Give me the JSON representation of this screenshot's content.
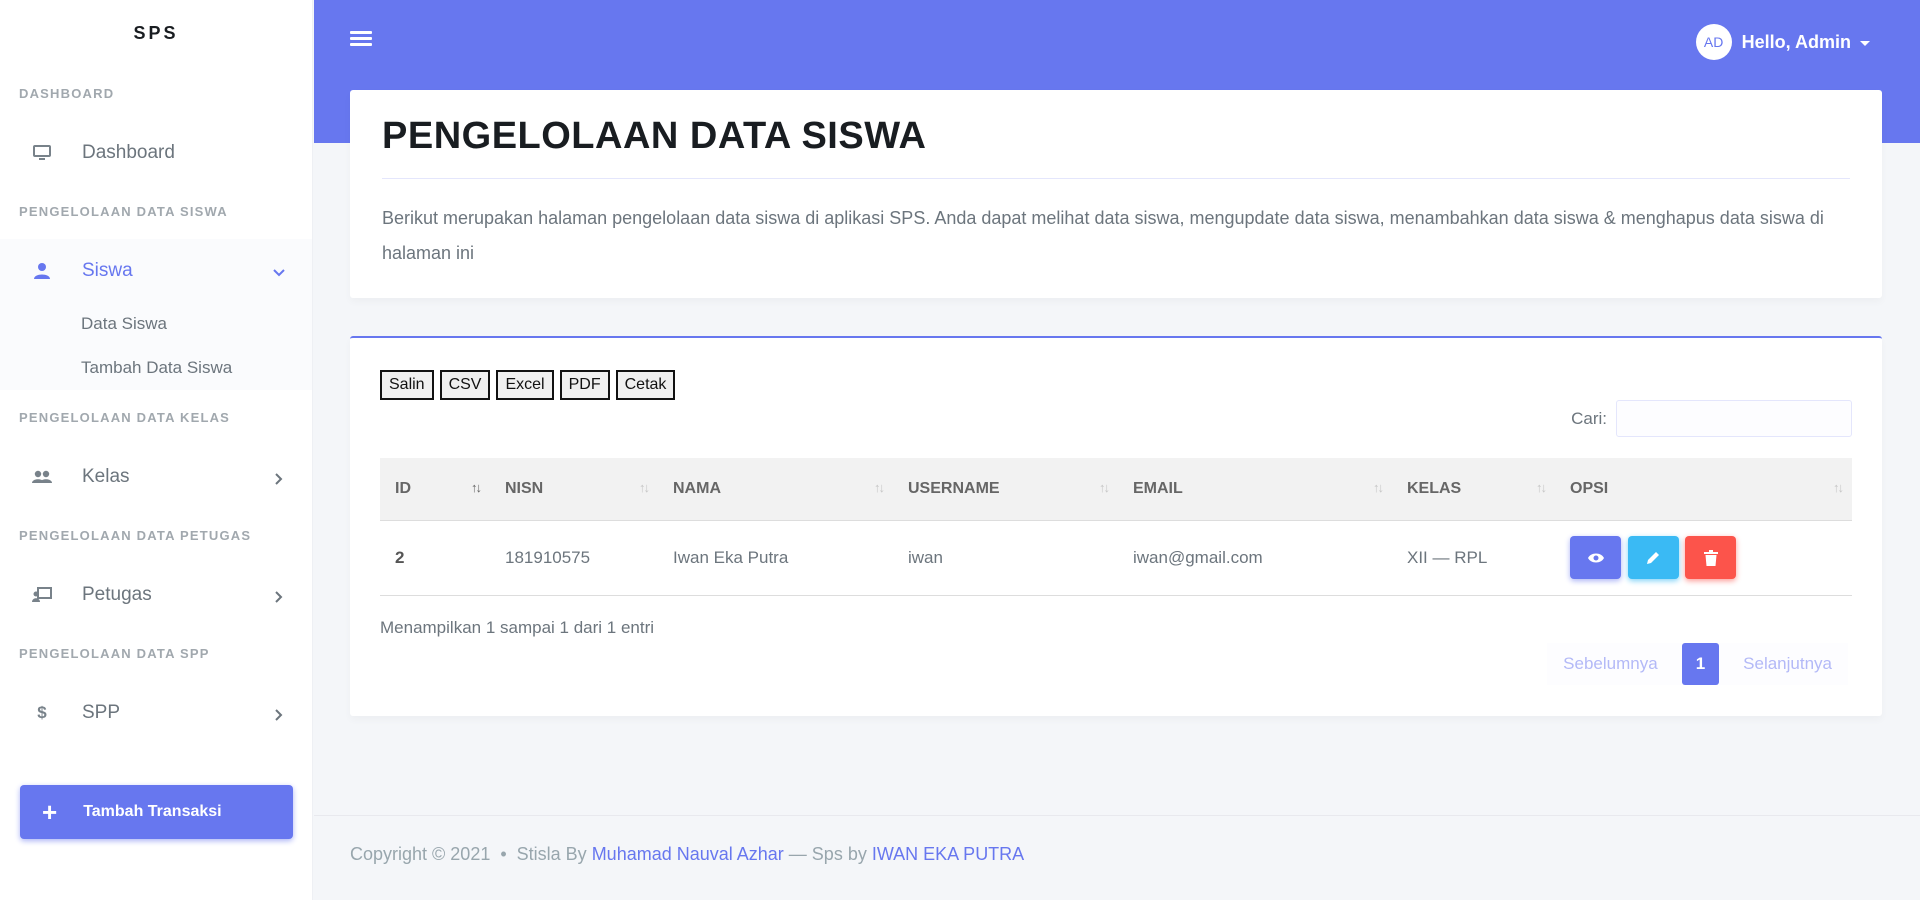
{
  "brand": "SPS",
  "sidebar": {
    "headers": {
      "dashboard": "DASHBOARD",
      "siswa": "PENGELOLAAN DATA SISWA",
      "kelas": "PENGELOLAAN DATA KELAS",
      "petugas": "PENGELOLAAN DATA PETUGAS",
      "spp": "PENGELOLAAN DATA SPP"
    },
    "items": {
      "dashboard": "Dashboard",
      "siswa": "Siswa",
      "data_siswa": "Data Siswa",
      "tambah_siswa": "Tambah Data Siswa",
      "kelas": "Kelas",
      "petugas": "Petugas",
      "spp": "SPP"
    },
    "button": "Tambah Transaksi"
  },
  "topbar": {
    "avatar_initials": "AD",
    "greeting": "Hello, Admin"
  },
  "header_card": {
    "title": "PENGELOLAAN DATA SISWA",
    "description": "Berikut merupakan halaman pengelolaan data siswa di aplikasi SPS. Anda dapat melihat data siswa, mengupdate data siswa, menambahkan data siswa & menghapus data siswa di halaman ini"
  },
  "table_card": {
    "export_buttons": [
      "Salin",
      "CSV",
      "Excel",
      "PDF",
      "Cetak"
    ],
    "search_label": "Cari:",
    "columns": [
      "ID",
      "NISN",
      "NAMA",
      "USERNAME",
      "EMAIL",
      "KELAS",
      "OPSI"
    ],
    "sort_glyph": "↑↓",
    "rows": [
      {
        "id": "2",
        "nisn": "181910575",
        "nama": "Iwan Eka Putra",
        "username": "iwan",
        "email": "iwan@gmail.com",
        "kelas": "XII — RPL"
      }
    ],
    "info": "Menampilkan 1 sampai 1 dari 1 entri",
    "pagination": {
      "prev": "Sebelumnya",
      "current": "1",
      "next": "Selanjutnya"
    }
  },
  "footer": {
    "prefix": "Copyright © 2021  •  Stisla By ",
    "author": "Muhamad Nauval Azhar",
    "mid": " — Sps by ",
    "sps_author": "IWAN EKA PUTRA"
  },
  "colors": {
    "primary": "#6777ef",
    "info": "#3abaf4",
    "danger": "#fc544b"
  }
}
